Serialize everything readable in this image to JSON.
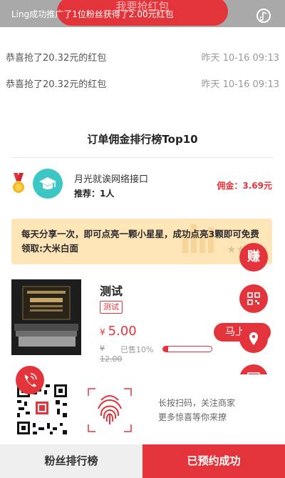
{
  "header": {
    "title": "我要抢红包",
    "ticker": "Ling成功推广了1位粉丝获得了2.00元红包",
    "music_icon": "music-note-icon"
  },
  "records": [
    {
      "text": "恭喜抢了20.32元的红包",
      "time": "昨天 10-16 09:13"
    },
    {
      "text": "恭喜抢了20.32元的红包",
      "time": "昨天 10-16 09:13"
    }
  ],
  "ranking": {
    "title": "订单佣金排行榜Top10",
    "entries": [
      {
        "name": "月光就诶网络接口",
        "recommend": "推荐：1人",
        "commission": "佣金：3.69元",
        "medal_icon": "gold-medal-icon",
        "avatar_icon": "graduation-cap-icon"
      }
    ]
  },
  "notice": {
    "text": "每天分享一次，即可点亮一颗小星星，成功点亮3颗即可免费领取:大米白面",
    "stars": "★★"
  },
  "product": {
    "title": "测试",
    "tag": "测试",
    "currency": "¥",
    "price": "5.00",
    "orig_currency": "¥",
    "orig_price": "12.00",
    "sold_text": "已售10%",
    "sold_fraction": 0.1,
    "rush_label": "马上"
  },
  "fabs": {
    "earn_label": "赚",
    "icons": [
      "qrcode-icon",
      "location-pin-icon",
      "list-icon",
      "chevron-right-icon"
    ]
  },
  "share": {
    "line1": "长按扫码，关注商家",
    "line2": "更多惊喜等你来撩"
  },
  "footer": {
    "left_label": "粉丝排行榜",
    "right_label": "已预约成功"
  },
  "colors": {
    "accent": "#e2343a",
    "notice_bg": "#fde5b8",
    "avatar": "#3cc7c5"
  }
}
